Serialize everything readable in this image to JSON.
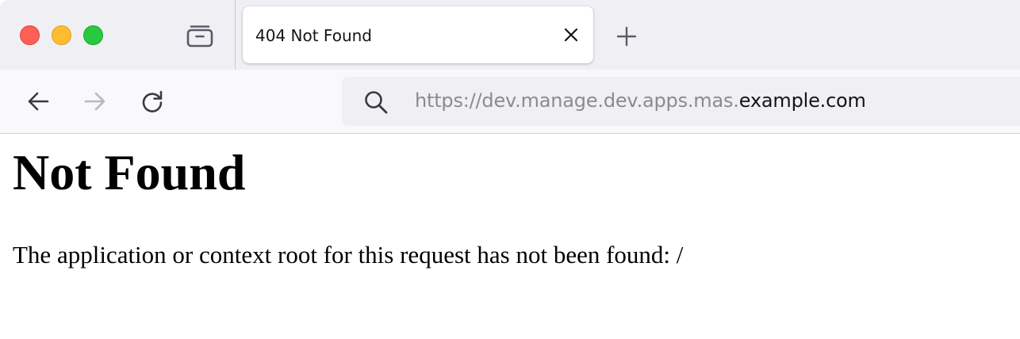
{
  "browser": {
    "tab": {
      "title": "404 Not Found"
    },
    "address_bar": {
      "url_prefix": "https://dev.manage.dev.apps.mas.",
      "url_domain": "example.com"
    },
    "icons": {
      "tabs": "tab-overview-icon",
      "close_tab": "close-icon",
      "new_tab": "plus-icon",
      "back": "arrow-left-icon",
      "forward": "arrow-right-icon",
      "reload": "reload-icon",
      "search": "search-icon"
    },
    "colors": {
      "close_light": "#fe5f57",
      "minimize_light": "#febc2e",
      "zoom_light": "#28c840"
    }
  },
  "page": {
    "heading": "Not Found",
    "message": "The application or context root for this request has not been found: /"
  }
}
